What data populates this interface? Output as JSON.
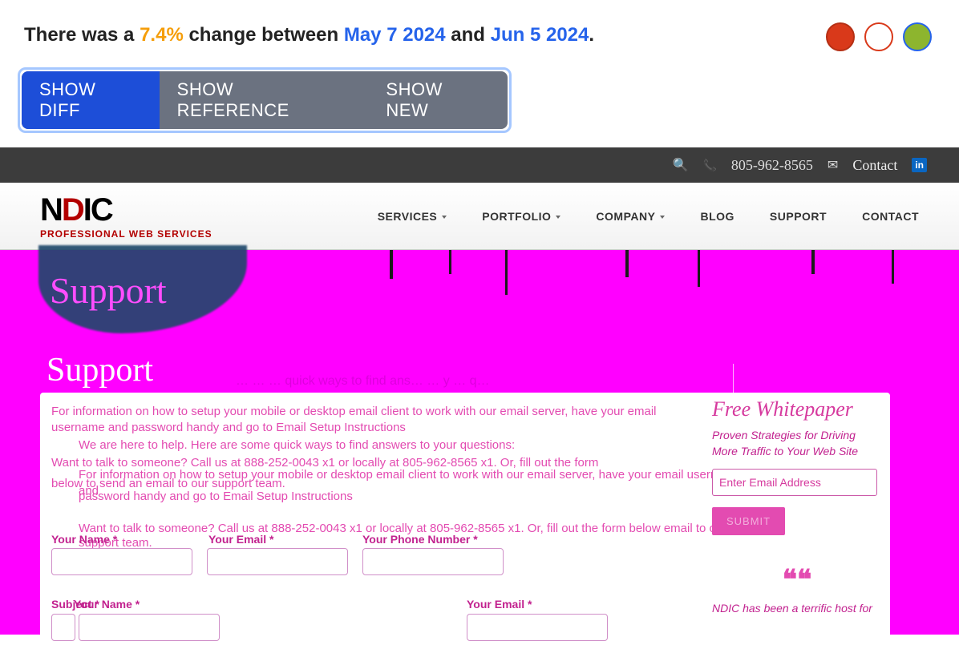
{
  "summary": {
    "prefix": "There was a ",
    "pct": "7.4%",
    "mid": " change between ",
    "date1": "May 7 2024",
    "and": " and ",
    "date2": "Jun 5 2024",
    "suffix": "."
  },
  "tabs": {
    "diff": "SHOW DIFF",
    "ref": "SHOW REFERENCE",
    "new": "SHOW NEW"
  },
  "topbar": {
    "phone": "805-962-8565",
    "contact": "Contact",
    "linkedin": "in"
  },
  "logo": {
    "n": "N",
    "d": "D",
    "ic": "IC",
    "sub": "PROFESSIONAL WEB SERVICES"
  },
  "menu": {
    "services": "SERVICES",
    "portfolio": "PORTFOLIO",
    "company": "COMPANY",
    "blog": "BLOG",
    "support": "SUPPORT",
    "contact": "CONTACT"
  },
  "hero": {
    "blob_word": "Support",
    "heading": "Support",
    "faint": "…  …  …  quick ways to find ans…  … y … q…",
    "p1": "For information on how to setup your mobile or desktop email client to work with our email server, have your email username and password handy and go to Email Setup Instructions",
    "p2": "We are here to help. Here are some quick ways to find answers to your questions:",
    "p3": "Want to talk to someone? Call us at 888-252-0043 x1 or locally at 805-962-8565 x1. Or, fill out the form",
    "p3b": "For information on how to setup your mobile or desktop email client to work with our email server, have your email username and",
    "p3c": "below to send an email to our support team.",
    "p4": "password handy and go to Email Setup Instructions",
    "p5": "Want to talk to someone? Call us at 888-252-0043 x1 or locally at 805-962-8565 x1. Or, fill out the form below             email to our",
    "p5b": "support team."
  },
  "form": {
    "name": "Your Name",
    "email": "Your Email",
    "phone": "Your Phone Number",
    "subject": "Subject",
    "star": " *"
  },
  "side": {
    "title": "Free Whitepaper",
    "sub": "Proven Strategies for Driving More Traffic to Your Web Site",
    "placeholder": "Enter Email Address",
    "submit": "SUBMIT",
    "quote_icon": "❝❝",
    "quote": "NDIC has been a terrific host for"
  }
}
